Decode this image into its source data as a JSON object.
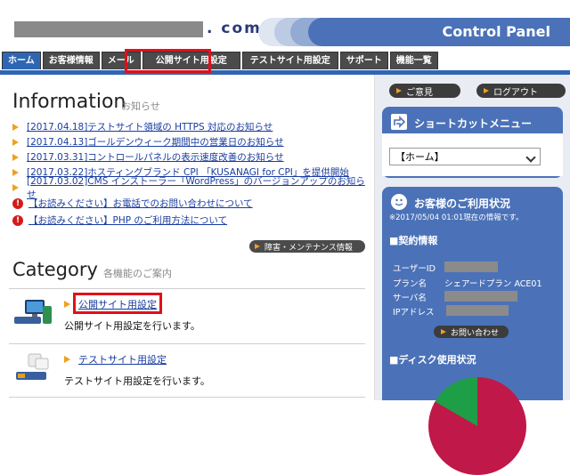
{
  "header": {
    "domain_suffix": ". com",
    "logo": "Control Panel"
  },
  "tabs": [
    {
      "label": "ホーム",
      "active": true
    },
    {
      "label": "お客様情報",
      "active": false
    },
    {
      "label": "メール",
      "active": false
    },
    {
      "label": "公開サイト用設定",
      "active": false
    },
    {
      "label": "テストサイト用設定",
      "active": false
    },
    {
      "label": "サポート",
      "active": false
    },
    {
      "label": "機能一覧",
      "active": false
    }
  ],
  "information": {
    "title": "Information",
    "subtitle": "お知らせ",
    "news": [
      "[2017.04.18]テストサイト領域の HTTPS 対応のお知らせ",
      "[2017.04.13]ゴールデンウィーク期間中の営業日のお知らせ",
      "[2017.03.31]コントロールパネルの表示速度改善のお知らせ",
      "[2017.03.22]ホスティングブランド CPI 「KUSANAGI for CPI」を提供開始",
      "[2017.03.02]CMS インストーラー「WordPress」のバージョンアップのお知らせ"
    ],
    "notices": [
      "【お読みください】お電話でのお問い合わせについて",
      "【お読みください】PHP のご利用方法について"
    ],
    "maintenance_button": "障害・メンテナンス情報"
  },
  "category": {
    "title": "Category",
    "subtitle": "各機能のご案内",
    "items": [
      {
        "link": "公開サイト用設定",
        "desc": "公開サイト用設定を行います。"
      },
      {
        "link": "テストサイト用設定",
        "desc": "テストサイト用設定を行います。"
      }
    ]
  },
  "sidebar": {
    "opinion_button": "ご意見",
    "logout_button": "ログアウト",
    "shortcut": {
      "title": "ショートカットメニュー",
      "selected": "【ホーム】"
    },
    "usage": {
      "title": "お客様のご利用状況",
      "timestamp": "※2017/05/04 01:01現在の情報です。",
      "contract_title": "■契約情報",
      "user_id_label": "ユーザーID",
      "plan_label": "プラン名",
      "plan_value": "シェアードプラン ACE01",
      "server_label": "サーバ名",
      "ip_label": "IPアドレス",
      "contact_button": "お問い合わせ",
      "disk_title": "■ディスク使用状況"
    }
  }
}
